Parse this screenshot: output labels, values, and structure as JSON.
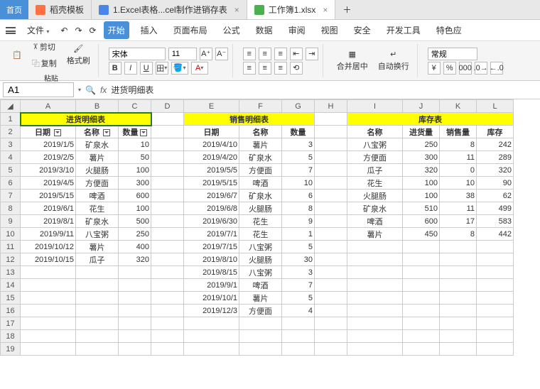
{
  "tabs": {
    "home": "首页",
    "t1": "稻壳模板",
    "t2": "1.Excel表格...cel制作进销存表",
    "t3": "工作簿1.xlsx"
  },
  "menu": {
    "file": "文件",
    "start": "开始",
    "insert": "插入",
    "layout": "页面布局",
    "formula": "公式",
    "data": "数据",
    "review": "审阅",
    "view": "视图",
    "safe": "安全",
    "dev": "开发工具",
    "special": "特色应"
  },
  "ribbon": {
    "cut": "剪切",
    "copy": "复制",
    "format": "格式刷",
    "paste": "粘贴",
    "font": "宋体",
    "size": "11",
    "merge": "合并居中",
    "wrap": "自动换行",
    "style": "常规",
    "B": "B",
    "I": "I",
    "U": "U"
  },
  "namebox": {
    "cell": "A1",
    "fx": "fx",
    "val": "进货明细表"
  },
  "sheet": {
    "cols": [
      "A",
      "B",
      "C",
      "D",
      "E",
      "F",
      "G",
      "H",
      "I",
      "J",
      "K",
      "L"
    ],
    "titles": {
      "t1": "进货明细表",
      "t2": "销售明细表",
      "t3": "库存表"
    },
    "hdr1": {
      "a": "日期",
      "b": "名称",
      "c": "数量"
    },
    "hdr2": {
      "a": "日期",
      "b": "名称",
      "c": "数量"
    },
    "hdr3": {
      "a": "名称",
      "b": "进货量",
      "c": "销售量",
      "d": "库存"
    },
    "buy": [
      [
        "2019/1/5",
        "矿泉水",
        "10"
      ],
      [
        "2019/2/5",
        "薯片",
        "50"
      ],
      [
        "2019/3/10",
        "火腿肠",
        "100"
      ],
      [
        "2019/4/5",
        "方便面",
        "300"
      ],
      [
        "2019/5/15",
        "啤酒",
        "600"
      ],
      [
        "2019/6/1",
        "花生",
        "100"
      ],
      [
        "2019/8/1",
        "矿泉水",
        "500"
      ],
      [
        "2019/9/11",
        "八宝粥",
        "250"
      ],
      [
        "2019/10/12",
        "薯片",
        "400"
      ],
      [
        "2019/10/15",
        "瓜子",
        "320"
      ]
    ],
    "sale": [
      [
        "2019/4/10",
        "薯片",
        "3"
      ],
      [
        "2019/4/20",
        "矿泉水",
        "5"
      ],
      [
        "2019/5/5",
        "方便面",
        "7"
      ],
      [
        "2019/5/15",
        "啤酒",
        "10"
      ],
      [
        "2019/6/7",
        "矿泉水",
        "6"
      ],
      [
        "2019/6/8",
        "火腿肠",
        "8"
      ],
      [
        "2019/6/30",
        "花生",
        "9"
      ],
      [
        "2019/7/1",
        "花生",
        "1"
      ],
      [
        "2019/7/15",
        "八宝粥",
        "5"
      ],
      [
        "2019/8/10",
        "火腿肠",
        "30"
      ],
      [
        "2019/8/15",
        "八宝粥",
        "3"
      ],
      [
        "2019/9/1",
        "啤酒",
        "7"
      ],
      [
        "2019/10/1",
        "薯片",
        "5"
      ],
      [
        "2019/12/3",
        "方便面",
        "4"
      ]
    ],
    "stock": [
      [
        "八宝粥",
        "250",
        "8",
        "242"
      ],
      [
        "方便面",
        "300",
        "11",
        "289"
      ],
      [
        "瓜子",
        "320",
        "0",
        "320"
      ],
      [
        "花生",
        "100",
        "10",
        "90"
      ],
      [
        "火腿肠",
        "100",
        "38",
        "62"
      ],
      [
        "矿泉水",
        "510",
        "11",
        "499"
      ],
      [
        "啤酒",
        "600",
        "17",
        "583"
      ],
      [
        "薯片",
        "450",
        "8",
        "442"
      ]
    ]
  }
}
